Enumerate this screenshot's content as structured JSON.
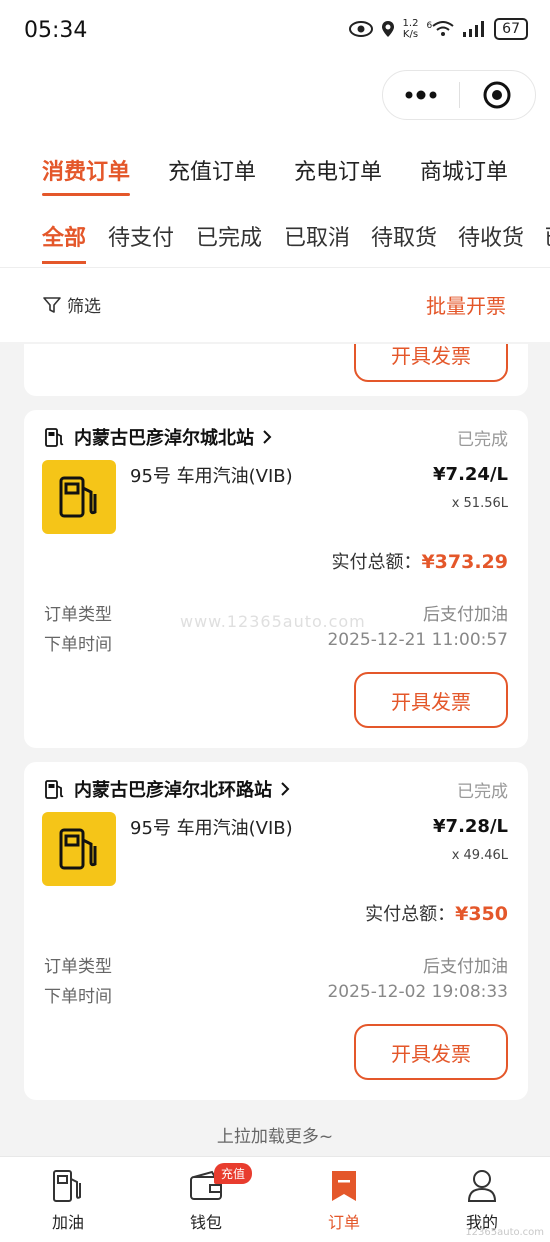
{
  "status_bar": {
    "time": "05:34",
    "net_speed_value": "1.2",
    "net_speed_unit": "K/s",
    "signal_label": "6",
    "battery": "67"
  },
  "tabs_main": [
    "消费订单",
    "充值订单",
    "充电订单",
    "商城订单"
  ],
  "tabs_sub": [
    "全部",
    "待支付",
    "已完成",
    "已取消",
    "待取货",
    "待收货",
    "已"
  ],
  "filter": {
    "label": "筛选",
    "batch_invoice": "批量开票"
  },
  "invoice_label": "开具发票",
  "orders": [
    {
      "station": "内蒙古巴彦淖尔城北站",
      "status": "已完成",
      "product": "95号 车用汽油(VIB)",
      "unit_price": "¥7.24/L",
      "quantity": "x 51.56L",
      "total_label": "实付总额：",
      "total": "¥373.29",
      "type_label": "订单类型",
      "type_value": "后支付加油",
      "time_label": "下单时间",
      "time_value": "2025-12-21 11:00:57"
    },
    {
      "station": "内蒙古巴彦淖尔北环路站",
      "status": "已完成",
      "product": "95号 车用汽油(VIB)",
      "unit_price": "¥7.28/L",
      "quantity": "x 49.46L",
      "total_label": "实付总额：",
      "total": "¥350",
      "type_label": "订单类型",
      "type_value": "后支付加油",
      "time_label": "下单时间",
      "time_value": "2025-12-02 19:08:33"
    }
  ],
  "load_more": "上拉加载更多~",
  "bottom_nav": [
    {
      "label": "加油",
      "icon": "fuel-pump-icon"
    },
    {
      "label": "钱包",
      "icon": "wallet-icon",
      "badge": "充值"
    },
    {
      "label": "订单",
      "icon": "order-bookmark-icon"
    },
    {
      "label": "我的",
      "icon": "profile-icon"
    }
  ],
  "watermark": "12365auto.com",
  "mid_watermark": "www.12365auto.com",
  "colors": {
    "accent": "#e4572a",
    "fuel_tile": "#f5c518",
    "badge": "#e83c2e"
  }
}
